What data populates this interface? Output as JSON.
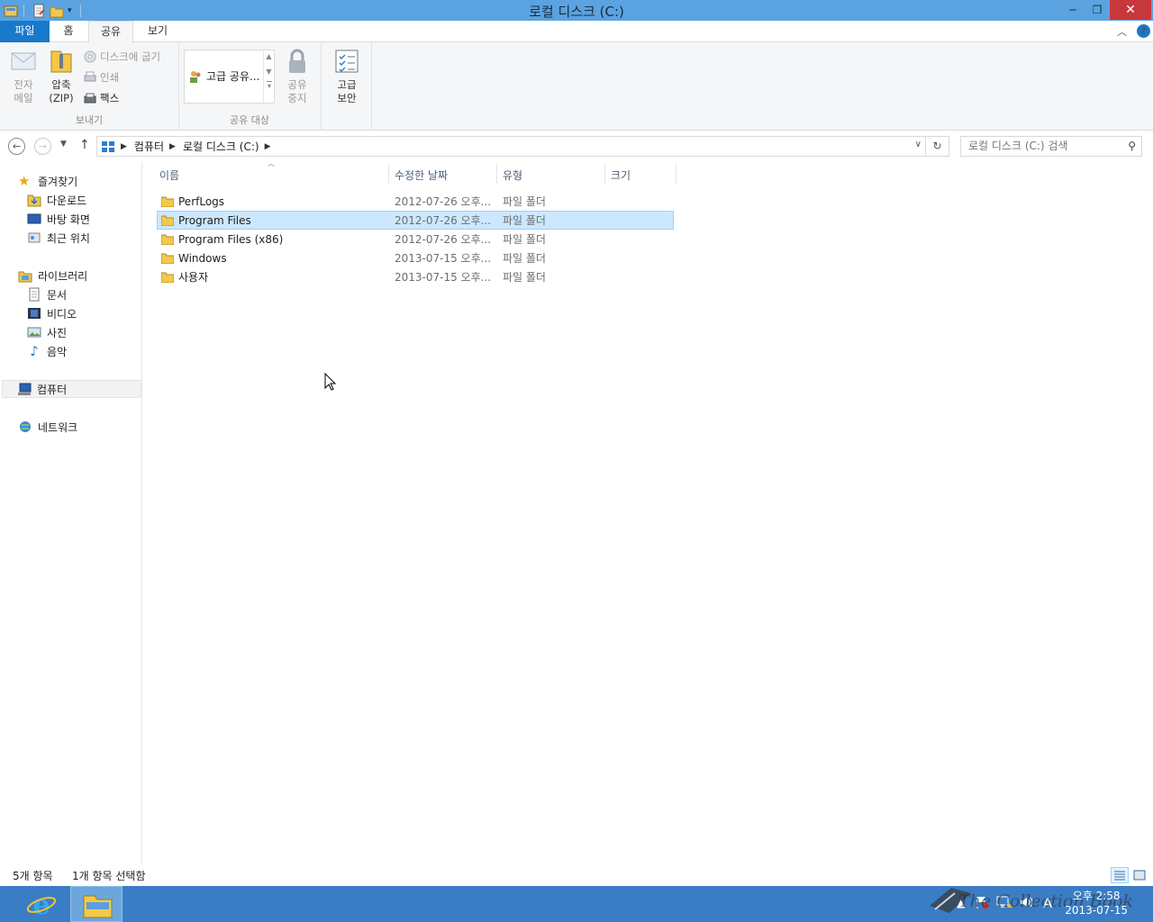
{
  "window": {
    "title": "로컬 디스크 (C:)",
    "minimize": "─",
    "restore": "❐",
    "close": "✕"
  },
  "ribbon_tabs": [
    "파일",
    "홈",
    "공유",
    "보기"
  ],
  "ribbon_controls": {
    "collapse": "︿",
    "help": "?"
  },
  "ribbon": {
    "send_group": {
      "label": "보내기",
      "email": "전자\n메일",
      "zip": "압축\n(ZIP)",
      "burn": "디스크에 굽기",
      "print": "인쇄",
      "fax": "팩스"
    },
    "share_group": {
      "label": "공유 대상",
      "gallery_item": "고급 공유...",
      "stop_sharing": "공유\n중지"
    },
    "advanced_security": "고급\n보안"
  },
  "address": {
    "crumbs": [
      "컴퓨터",
      "로컬 디스크 (C:)"
    ],
    "search_placeholder": "로컬 디스크 (C:) 검색"
  },
  "nav_pane": {
    "favorites": "즐겨찾기",
    "downloads": "다운로드",
    "desktop": "바탕 화면",
    "recent": "최근 위치",
    "libraries": "라이브러리",
    "documents": "문서",
    "videos": "비디오",
    "pictures": "사진",
    "music": "음악",
    "computer": "컴퓨터",
    "network": "네트워크"
  },
  "columns": {
    "name": "이름",
    "modified": "수정한 날짜",
    "type": "유형",
    "size": "크기"
  },
  "files": [
    {
      "name": "PerfLogs",
      "modified": "2012-07-26 오후...",
      "type": "파일 폴더",
      "selected": false
    },
    {
      "name": "Program Files",
      "modified": "2012-07-26 오후...",
      "type": "파일 폴더",
      "selected": true
    },
    {
      "name": "Program Files (x86)",
      "modified": "2012-07-26 오후...",
      "type": "파일 폴더",
      "selected": false
    },
    {
      "name": "Windows",
      "modified": "2013-07-15 오후...",
      "type": "파일 폴더",
      "selected": false
    },
    {
      "name": "사용자",
      "modified": "2013-07-15 오후...",
      "type": "파일 폴더",
      "selected": false
    }
  ],
  "status": {
    "item_count": "5개 항목",
    "selected_count": "1개 항목 선택함"
  },
  "taskbar": {
    "clock_time": "오후 2:58",
    "clock_date": "2013-07-15",
    "ime": "A",
    "watermark": "The Collection Book"
  },
  "colors": {
    "titlebar": "#5aa3e0",
    "file_tab": "#1979ca",
    "selection": "#cce8ff",
    "taskbar": "#3b7dc4"
  }
}
